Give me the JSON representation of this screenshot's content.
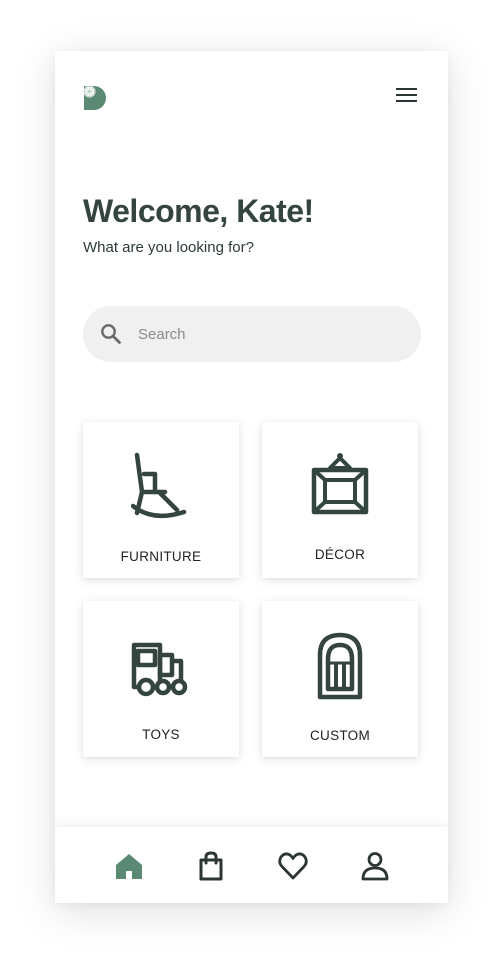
{
  "header": {
    "logo_icon": "leaf-d-logo-icon",
    "menu_icon": "hamburger-menu-icon"
  },
  "greeting": {
    "title": "Welcome, Kate!",
    "subtitle": "What are you looking for?"
  },
  "search": {
    "placeholder": "Search",
    "value": "",
    "icon": "search-icon"
  },
  "categories": [
    {
      "label": "FURNITURE",
      "icon": "rocking-chair-icon"
    },
    {
      "label": "DÉCOR",
      "icon": "frame-icon"
    },
    {
      "label": "TOYS",
      "icon": "toy-train-icon"
    },
    {
      "label": "CUSTOM",
      "icon": "arched-window-icon"
    }
  ],
  "bottom_nav": [
    {
      "name": "home",
      "icon": "home-icon",
      "active": true
    },
    {
      "name": "shop",
      "icon": "shopping-bag-icon",
      "active": false
    },
    {
      "name": "favorites",
      "icon": "heart-icon",
      "active": false
    },
    {
      "name": "profile",
      "icon": "user-icon",
      "active": false
    }
  ],
  "colors": {
    "primary_dark": "#344440",
    "accent_green": "#5b8a74",
    "background": "#ffffff",
    "search_bg": "#f0f0f0"
  }
}
